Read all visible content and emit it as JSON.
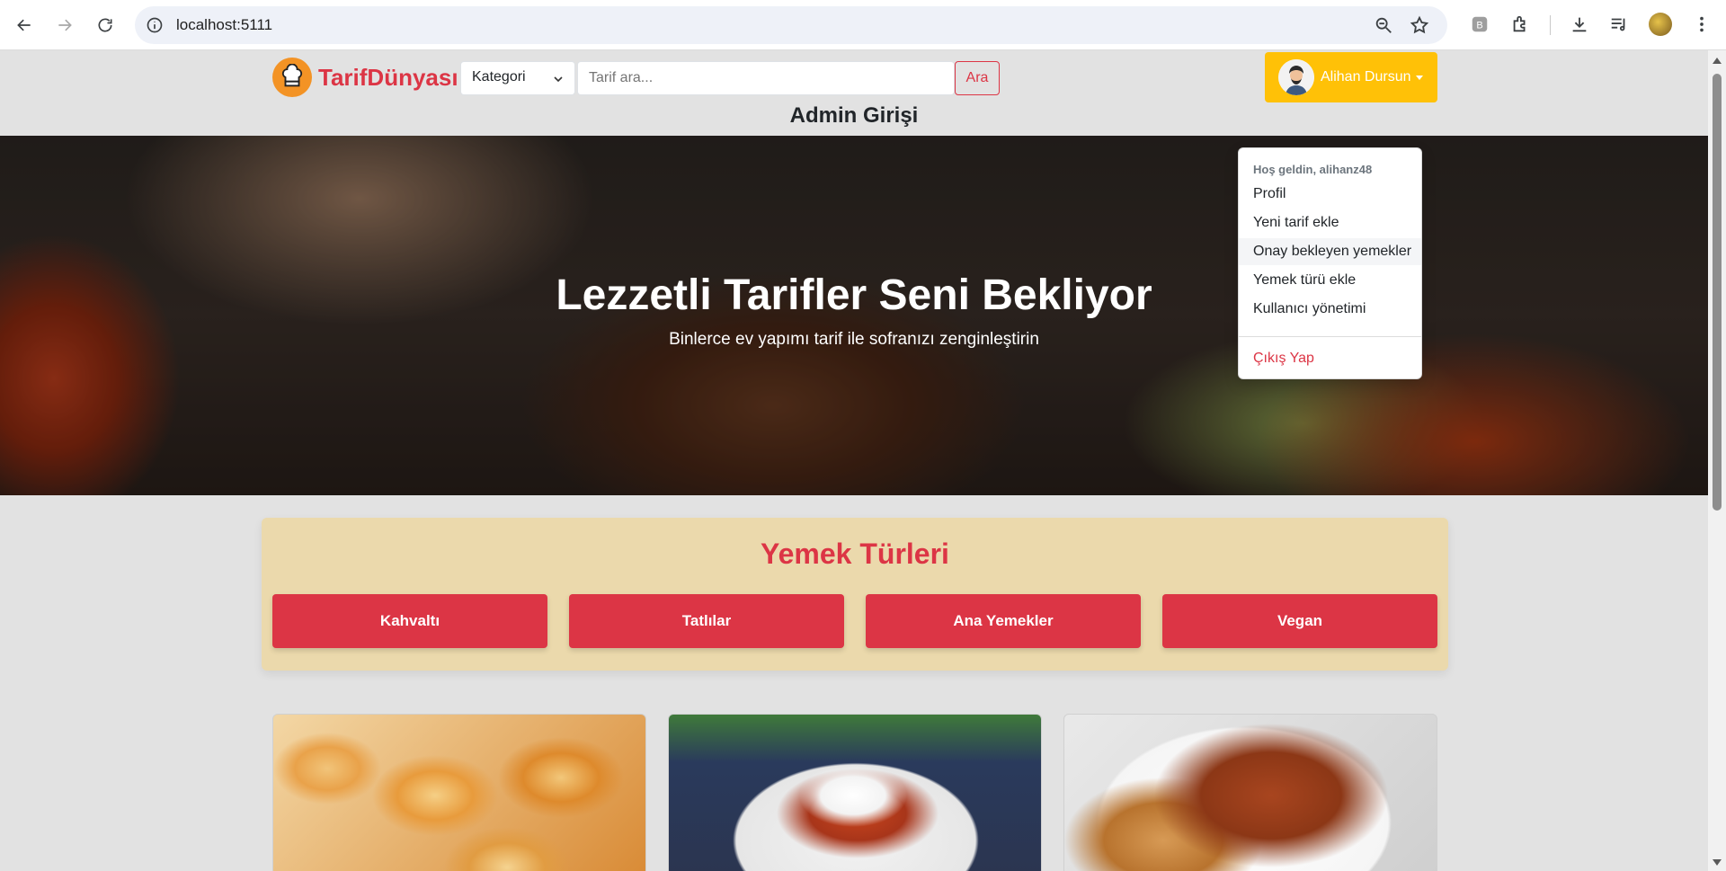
{
  "browser": {
    "url": "localhost:5111"
  },
  "header": {
    "brand": "TarifDünyası",
    "category_select": "Kategori",
    "search_placeholder": "Tarif ara...",
    "search_button": "Ara",
    "user_name": "Alihan Dursun",
    "admin_title": "Admin Girişi"
  },
  "dropdown": {
    "greeting": "Hoş geldin, alihanz48",
    "items": [
      {
        "label": "Profil"
      },
      {
        "label": "Yeni tarif ekle"
      },
      {
        "label": "Onay bekleyen yemekler"
      },
      {
        "label": "Yemek türü ekle"
      },
      {
        "label": "Kullanıcı yönetimi"
      }
    ],
    "logout": "Çıkış Yap"
  },
  "hero": {
    "title": "Lezzetli Tarifler Seni Bekliyor",
    "subtitle": "Binlerce ev yapımı tarif ile sofranızı zenginleştirin"
  },
  "food_types": {
    "heading": "Yemek Türleri",
    "buttons": [
      "Kahvaltı",
      "Tatlılar",
      "Ana Yemekler",
      "Vegan"
    ]
  },
  "colors": {
    "brand_red": "#dc3545",
    "user_yellow": "#ffc107",
    "logo_orange": "#f39325",
    "section_bg": "#ebd9ac"
  }
}
